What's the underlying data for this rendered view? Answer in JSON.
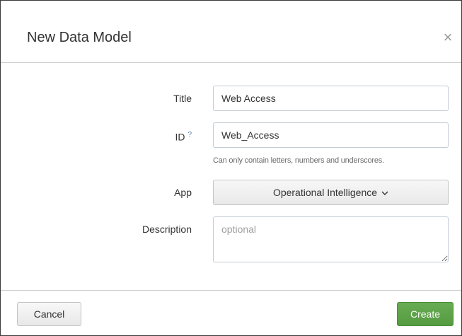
{
  "dialog": {
    "title": "New Data Model",
    "close_glyph": "×"
  },
  "form": {
    "title": {
      "label": "Title",
      "value": "Web Access"
    },
    "id": {
      "label": "ID",
      "help_glyph": "?",
      "value": "Web_Access",
      "help_text": "Can only contain letters, numbers and underscores."
    },
    "app": {
      "label": "App",
      "selected": "Operational Intelligence"
    },
    "description": {
      "label": "Description",
      "value": "",
      "placeholder": "optional"
    }
  },
  "footer": {
    "cancel_label": "Cancel",
    "create_label": "Create"
  },
  "colors": {
    "primary_button": "#5a9f45",
    "help_link": "#5379af",
    "border": "#c3cbd4"
  },
  "icons": {
    "close": "close-icon",
    "dropdown": "chevron-down-icon",
    "help": "help-icon"
  }
}
